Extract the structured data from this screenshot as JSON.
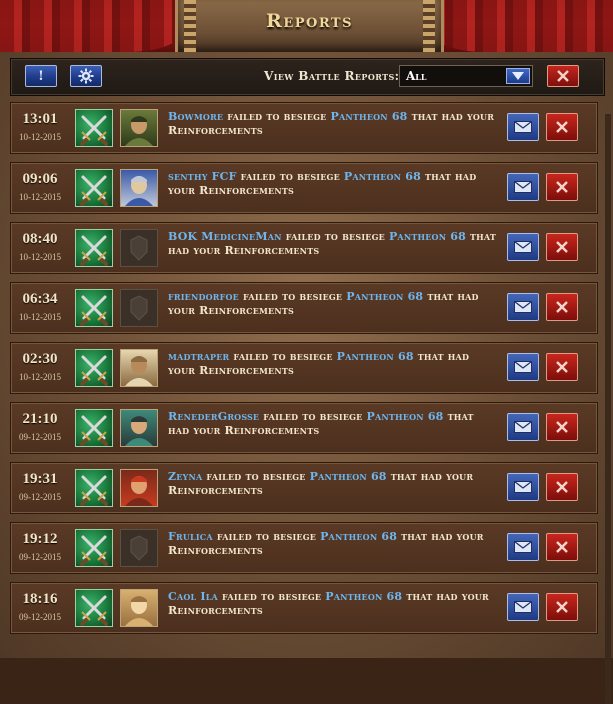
{
  "header": {
    "title": "Reports"
  },
  "toolbar": {
    "alert_label": "!",
    "filter_label": "View Battle Reports:",
    "filter_value": "All"
  },
  "colors": {
    "player_name": "#6fb6ee",
    "mail_button": "#2b4c9e",
    "delete_button": "#a8190f"
  },
  "reports": [
    {
      "time": "13:01",
      "date": "10-12-2015",
      "player": "Bowmore",
      "action": "failed to besiege",
      "target": "Pantheon 68",
      "suffix": "that had your Reinforcements",
      "portrait": "soldier-portrait"
    },
    {
      "time": "09:06",
      "date": "10-12-2015",
      "player": "senthy FCF",
      "action": "failed to besiege",
      "target": "Pantheon 68",
      "suffix": "that had your Reinforcements",
      "portrait": "viking-portrait"
    },
    {
      "time": "08:40",
      "date": "10-12-2015",
      "player": "BOK MedicineMan",
      "action": "failed to besiege",
      "target": "Pantheon 68",
      "suffix": "that had your Reinforcements",
      "portrait": "empty-portrait"
    },
    {
      "time": "06:34",
      "date": "10-12-2015",
      "player": "friendorfoe",
      "action": "failed to besiege",
      "target": "Pantheon 68",
      "suffix": "that had your Reinforcements",
      "portrait": "empty-portrait"
    },
    {
      "time": "02:30",
      "date": "10-12-2015",
      "player": "madtraper",
      "action": "failed to besiege",
      "target": "Pantheon 68",
      "suffix": "that had your Reinforcements",
      "portrait": "bearded-portrait"
    },
    {
      "time": "21:10",
      "date": "09-12-2015",
      "player": "RenederGroße",
      "action": "failed to besiege",
      "target": "Pantheon 68",
      "suffix": "that had your Reinforcements",
      "portrait": "warrior-portrait"
    },
    {
      "time": "19:31",
      "date": "09-12-2015",
      "player": "Zeyna",
      "action": "failed to besiege",
      "target": "Pantheon 68",
      "suffix": "that had your Reinforcements",
      "portrait": "archer-portrait"
    },
    {
      "time": "19:12",
      "date": "09-12-2015",
      "player": "Frulica",
      "action": "failed to besiege",
      "target": "Pantheon 68",
      "suffix": "that had your Reinforcements",
      "portrait": "empty-portrait"
    },
    {
      "time": "18:16",
      "date": "09-12-2015",
      "player": "Caol Ila",
      "action": "failed to besiege",
      "target": "Pantheon 68",
      "suffix": "that had your Reinforcements",
      "portrait": "knight-portrait"
    }
  ]
}
